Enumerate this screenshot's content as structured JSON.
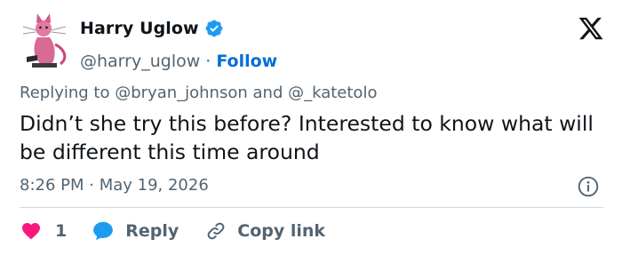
{
  "author": {
    "display_name": "Harry Uglow",
    "handle": "@harry_uglow",
    "separator": "·",
    "follow_label": "Follow",
    "verified": true
  },
  "reply_context": {
    "prefix": "Replying to",
    "mention_1": "@bryan_johnson",
    "joiner": "and",
    "mention_2": "@_katetolo"
  },
  "tweet": {
    "text": "Didn’t she try this before? Interested to know what will be different this time around",
    "timestamp": "8:26 PM · May 19, 2026"
  },
  "actions": {
    "like_count": "1",
    "reply_label": "Reply",
    "copy_link_label": "Copy link"
  },
  "icons": {
    "verified": "verified-badge-icon",
    "x_logo": "x-logo-icon",
    "info": "info-icon",
    "like": "heart-icon",
    "reply": "speech-bubble-icon",
    "copy_link": "link-icon"
  },
  "colors": {
    "accent": "#006fd6",
    "verified_badge": "#1d9bf0",
    "like": "#f91880",
    "muted_text": "#536471",
    "primary_text": "#0f1419",
    "divider": "#cfd9de"
  }
}
